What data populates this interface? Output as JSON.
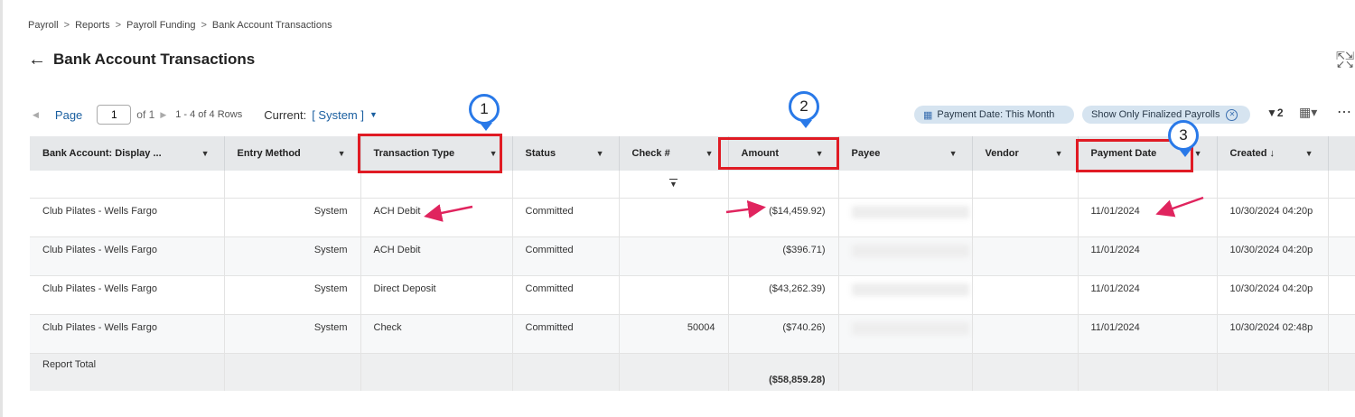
{
  "breadcrumb": [
    "Payroll",
    "Reports",
    "Payroll Funding",
    "Bank Account Transactions"
  ],
  "breadcrumb_sep": ">",
  "page_title": "Bank Account Transactions",
  "pager": {
    "page_label": "Page",
    "page_value": "1",
    "of_label": "of 1",
    "rows_label": "1 - 4 of 4 Rows",
    "current_label": "Current:",
    "current_value": "[ System ]"
  },
  "filters": {
    "chip1": "Payment Date: This Month",
    "chip2": "Show Only Finalized Payrolls",
    "filter_count": "2"
  },
  "columns": [
    "Bank Account: Display ...",
    "Entry Method",
    "Transaction Type",
    "Status",
    "Check #",
    "Amount",
    "Payee",
    "Vendor",
    "Payment Date",
    "Created"
  ],
  "rows": [
    {
      "bank": "Club Pilates - Wells Fargo",
      "method": "System",
      "type": "ACH Debit",
      "status": "Committed",
      "check": "",
      "amount": "($14,459.92)",
      "payment_date": "11/01/2024",
      "created": "10/30/2024 04:20p"
    },
    {
      "bank": "Club Pilates - Wells Fargo",
      "method": "System",
      "type": "ACH Debit",
      "status": "Committed",
      "check": "",
      "amount": "($396.71)",
      "payment_date": "11/01/2024",
      "created": "10/30/2024 04:20p"
    },
    {
      "bank": "Club Pilates - Wells Fargo",
      "method": "System",
      "type": "Direct Deposit",
      "status": "Committed",
      "check": "",
      "amount": "($43,262.39)",
      "payment_date": "11/01/2024",
      "created": "10/30/2024 04:20p"
    },
    {
      "bank": "Club Pilates - Wells Fargo",
      "method": "System",
      "type": "Check",
      "status": "Committed",
      "check": "50004",
      "amount": "($740.26)",
      "payment_date": "11/01/2024",
      "created": "10/30/2024 02:48p"
    }
  ],
  "total": {
    "label": "Report Total",
    "amount": "($58,859.28)"
  },
  "annotations": [
    "1",
    "2",
    "3"
  ],
  "colors": {
    "highlight_box": "#e01b24",
    "pin": "#2979e8",
    "arrow": "#e0245e",
    "link": "#1a5fa0",
    "header_bg": "#e6e8ea"
  },
  "icons": [
    "back-arrow-icon",
    "expand-icon",
    "calendar-icon",
    "close-circle-icon",
    "filter-icon",
    "export-icon",
    "more-icon",
    "sort-down-icon"
  ]
}
